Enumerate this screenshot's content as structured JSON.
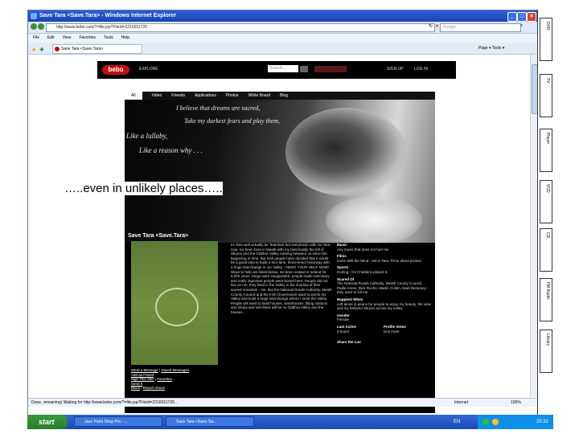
{
  "window": {
    "title": "Save Tara <Save.Tara> - Windows Internet Explorer",
    "address": "http://www.bebo.com/?=file.jsp?FileId=2216011720",
    "search_placeholder": "Google",
    "menu": [
      "File",
      "Edit",
      "View",
      "Favorites",
      "Tools",
      "Help"
    ],
    "tab_label": "Save Tara <Save.Tara>",
    "tab_tools": "Page ▾   Tools ▾",
    "status_text": "Done, remaining) Waiting for http://www.bebo.com/?=file.jsp?FileId=2216011720...",
    "status_zone": "Internet",
    "status_zoom": "100%"
  },
  "bebo": {
    "logo": "bebo",
    "explore": "EXPLORE",
    "search_placeholder": "Search...",
    "signup": "SIGN UP",
    "login": "LOG IN"
  },
  "nav": [
    "All",
    "Video",
    "Friends",
    "Applications",
    "Photos",
    "White Board",
    "Blog"
  ],
  "hero_quote": [
    "I believe that dreams are sacred,",
    "Take my darkest fears and play them,",
    "Like a lullaby,",
    "Like a reason why . . ."
  ],
  "overlay_caption": "…..even in unlikely places…..",
  "profile": {
    "name": "Save Tara <Save.Tara>",
    "bio": "Im Tara well actually be Teamhair but everybody calls me Tara now. Ive been here in Meath with my best buddy the hill of Skryne and the Gabhra Valley running between us since the beginning of time. But Irish people have decided that it would be a good idea to build a four-lane, fence-lined motorway with a huge interchange in our Valley. I NEED YOUR HELP NOW! Ways to help are listed below. Ive been seated in Ireland for 5,000 years. Kings were inaugurated, people made sanctuary and really important people were buried here. People did not live on me, they lived in the Valley in the shadow of their sacred mountain - me. But the National Roads Authority, Meath County Council and the Irish Government want to wreck my Valley and build a huge interchange where I meet the Valley. People will want to build houses, warehouses, filling stations and shops and see there will be no Gabhra Valley and the houses...",
    "links": [
      "Send a Message",
      "Saved Messages",
      "Add as Friend",
      "Sign This Skin",
      "Favorites",
      "Send It",
      "Block",
      "Report Abuse"
    ],
    "details": [
      {
        "label": "Music",
        "value": "Any music that does not hurt me"
      },
      {
        "label": "Films",
        "value": "Gone with the Wind - set in Tara. Films about protest"
      },
      {
        "label": "Sports",
        "value": "Hurling - DJ Chubbins played it."
      },
      {
        "label": "Scared Of",
        "value": "The National Roads Authority, Meath County Council, Padie Arens, Dick Roche, Martin Cullen, Noel Dempsey - they want to kill me"
      },
      {
        "label": "Happiest When",
        "value": "Left alone in peace for people to enjoy my beauty, the view and my beloved Skryne across my valley"
      },
      {
        "label": "Gender",
        "value": "Female"
      }
    ],
    "last_active_label": "Last Active",
    "last_active_value": "5 hours",
    "profile_views_label": "Profile Views",
    "profile_views_value": "lock more",
    "share_label": "Share the Luv"
  },
  "sidebar": [
    "DVD",
    "TV",
    "Player",
    "VCD",
    "CD",
    "FM Radio",
    "Library"
  ],
  "taskbar": {
    "start": "start",
    "buttons": [
      "Jasc Paint Shop Pro - ...",
      "Save Tara <Save.Tar..."
    ],
    "lang": "EN",
    "clock": "20:31"
  },
  "colors": {
    "ie_blue": "#1a44b4",
    "bebo_red": "#c01010",
    "page_black": "#000000",
    "taskbar_blue": "#1c48b5",
    "start_green": "#2a7d2a"
  }
}
